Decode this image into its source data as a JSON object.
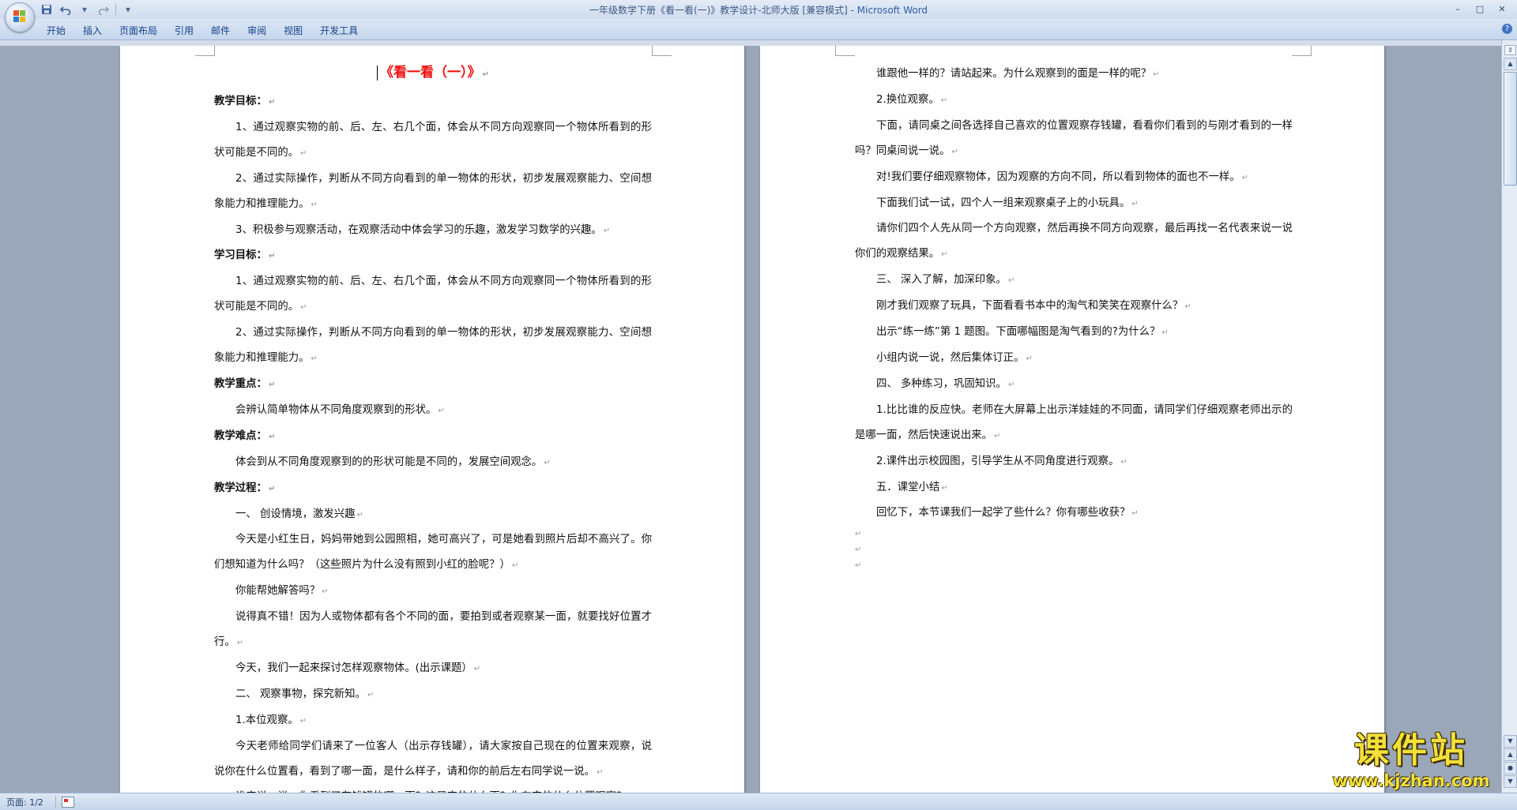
{
  "window": {
    "title": "一年级数学下册《看一看(一)》教学设计-北师大版 [兼容模式] - ",
    "app_name": "Microsoft Word",
    "controls": [
      "–",
      "□",
      "✕"
    ]
  },
  "quick_access": {
    "save_icon": "save-icon",
    "undo_icon": "undo-icon",
    "redo_icon": "redo-icon",
    "customize_symbol": "▾"
  },
  "ribbon": {
    "tabs": [
      "开始",
      "插入",
      "页面布局",
      "引用",
      "邮件",
      "审阅",
      "视图",
      "开发工具"
    ],
    "help_symbol": "?"
  },
  "document": {
    "left_page": {
      "title": "《看一看（一）》",
      "paragraphs": [
        {
          "text": "教学目标：",
          "style": "b"
        },
        {
          "text": "1、通过观察实物的前、后、左、右几个面，体会从不同方向观察同一个物体所看到的形状可能是不同的。",
          "style": "ind"
        },
        {
          "text": "2、通过实际操作，判断从不同方向看到的单一物体的形状，初步发展观察能力、空间想象能力和推理能力。",
          "style": "ind"
        },
        {
          "text": "3、积极参与观察活动，在观察活动中体会学习的乐趣，激发学习数学的兴趣。",
          "style": "ind"
        },
        {
          "text": "学习目标：",
          "style": "b"
        },
        {
          "text": "1、通过观察实物的前、后、左、右几个面，体会从不同方向观察同一个物体所看到的形状可能是不同的。",
          "style": "ind"
        },
        {
          "text": "2、通过实际操作，判断从不同方向看到的单一物体的形状，初步发展观察能力、空间想象能力和推理能力。",
          "style": "ind"
        },
        {
          "text": "教学重点：",
          "style": "b"
        },
        {
          "text": "会辨认简单物体从不同角度观察到的形状。",
          "style": "ind"
        },
        {
          "text": "教学难点：",
          "style": "b"
        },
        {
          "text": "体会到从不同角度观察到的的形状可能是不同的，发展空间观念。",
          "style": "ind"
        },
        {
          "text": "教学过程：",
          "style": "b"
        },
        {
          "text": "一、 创设情境，激发兴趣",
          "style": "ind"
        },
        {
          "text": "今天是小红生日，妈妈带她到公园照相，她可高兴了，可是她看到照片后却不高兴了。你们想知道为什么吗？（这些照片为什么没有照到小红的脸呢？）",
          "style": "ind"
        },
        {
          "text": "你能帮她解答吗？",
          "style": "ind"
        },
        {
          "text": "说得真不错！因为人或物体都有各个不同的面，要拍到或者观察某一面，就要找好位置才行。",
          "style": "ind"
        },
        {
          "text": "今天，我们一起来探讨怎样观察物体。(出示课题）",
          "style": "ind"
        },
        {
          "text": "二、 观察事物，探究新知。",
          "style": "ind"
        },
        {
          "text": "1.本位观察。",
          "style": "ind"
        },
        {
          "text": "今天老师给同学们请来了一位客人（出示存钱罐），请大家按自己现在的位置来观察，说说你在什么位置看，看到了哪一面，是什么样子，请和你的前后左右同学说一说。",
          "style": "ind"
        },
        {
          "text": "谁来说一说：你看到了存钱罐的哪一面？这是它的什么面？你在它的什么位置观察？",
          "style": "ind"
        }
      ]
    },
    "right_page": {
      "paragraphs": [
        {
          "text": "谁跟他一样的？请站起来。为什么观察到的面是一样的呢？",
          "style": "ind"
        },
        {
          "text": "2.换位观察。",
          "style": "ind"
        },
        {
          "text": "下面，请同桌之间各选择自己喜欢的位置观察存钱罐，看看你们看到的与刚才看到的一样吗？同桌间说一说。",
          "style": "ind"
        },
        {
          "text": "对!我们要仔细观察物体，因为观察的方向不同，所以看到物体的面也不一样。",
          "style": "ind"
        },
        {
          "text": "下面我们试一试，四个人一组来观察桌子上的小玩具。",
          "style": "ind"
        },
        {
          "text": "请你们四个人先从同一个方向观察，然后再换不同方向观察，最后再找一名代表来说一说你们的观察结果。",
          "style": "ind"
        },
        {
          "text": "三、 深入了解，加深印象。",
          "style": "ind"
        },
        {
          "text": "刚才我们观察了玩具，下面看看书本中的淘气和笑笑在观察什么？",
          "style": "ind"
        },
        {
          "text": "出示“练一练”第 1 题图。下面哪幅图是淘气看到的?为什么？",
          "style": "ind"
        },
        {
          "text": "小组内说一说，然后集体订正。",
          "style": "ind"
        },
        {
          "text": "四、 多种练习，巩固知识。",
          "style": "ind"
        },
        {
          "text": "1.比比谁的反应快。老师在大屏幕上出示洋娃娃的不同面，请同学们仔细观察老师出示的是哪一面，然后快速说出来。",
          "style": "ind"
        },
        {
          "text": "2.课件出示校园图，引导学生从不同角度进行观察。",
          "style": "ind"
        },
        {
          "text": "五．课堂小结",
          "style": "ind"
        },
        {
          "text": "回忆下，本节课我们一起学了些什么？你有哪些收获？",
          "style": "ind"
        }
      ],
      "empty_lines": 3
    },
    "paragraph_mark": "↵"
  },
  "status_bar": {
    "page_info": "页面: 1/2"
  },
  "watermark": {
    "main": "课件站",
    "url": "www.kjzhan.com"
  },
  "colors": {
    "title_red": "#ee1111",
    "ribbon_text": "#15428b",
    "watermark_yellow": "#f3e03a"
  }
}
